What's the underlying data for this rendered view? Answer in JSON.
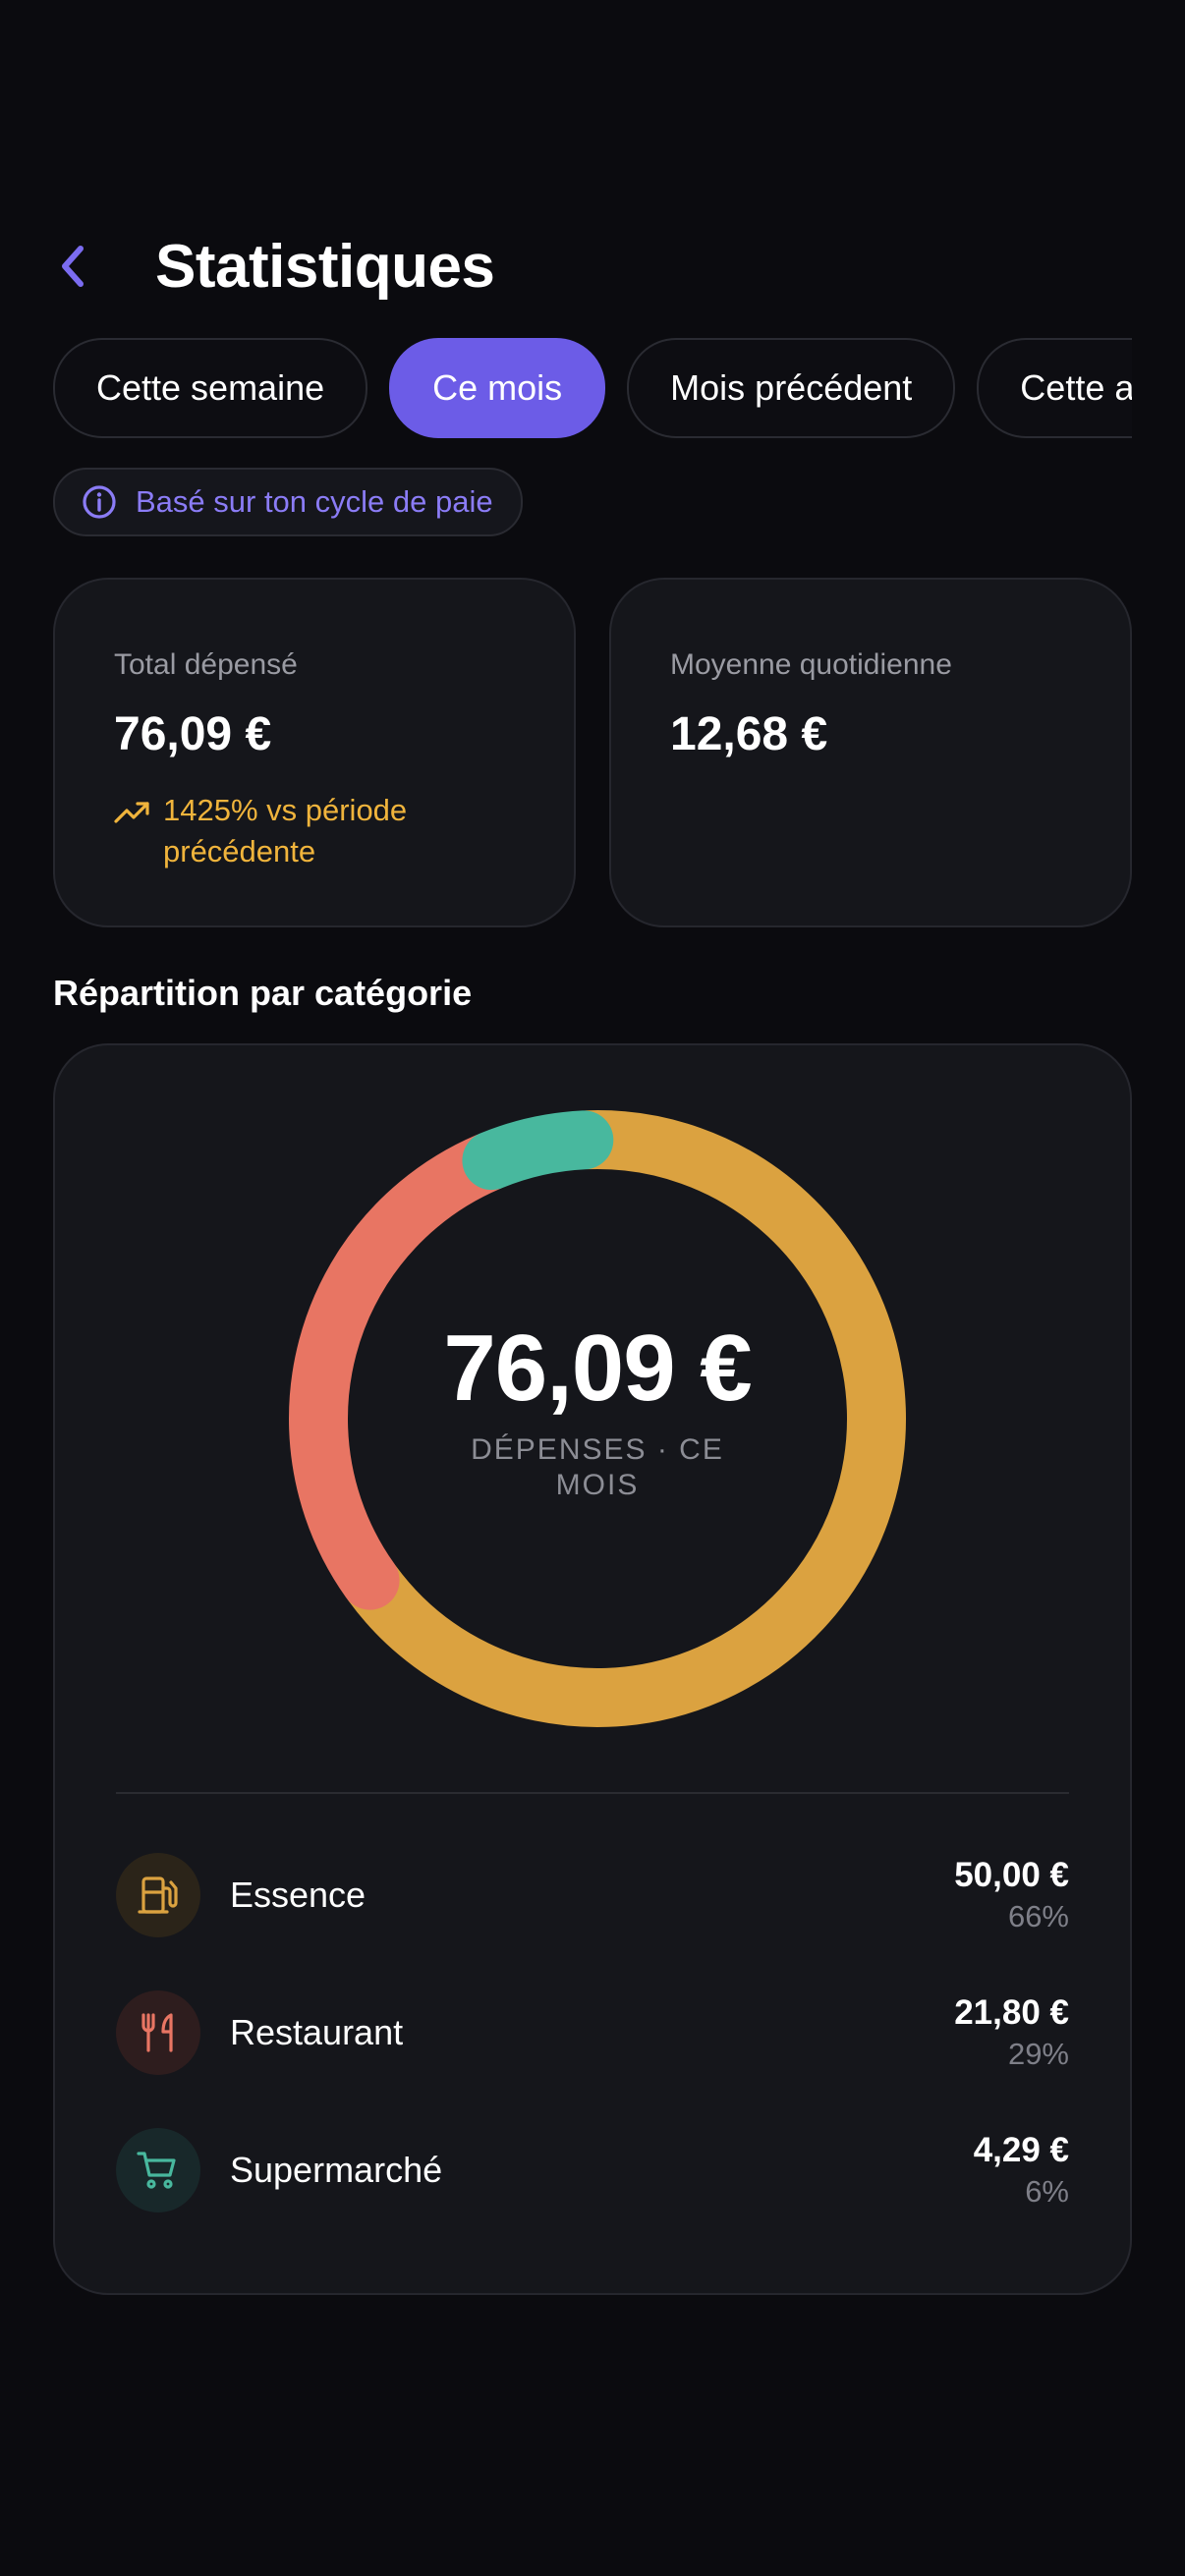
{
  "header": {
    "title": "Statistiques"
  },
  "tabs": [
    {
      "label": "Cette semaine",
      "active": false
    },
    {
      "label": "Ce mois",
      "active": true
    },
    {
      "label": "Mois précédent",
      "active": false
    },
    {
      "label": "Cette année",
      "active": false
    }
  ],
  "info": {
    "text": "Basé sur ton cycle de paie"
  },
  "stats": {
    "total": {
      "label": "Total dépensé",
      "value": "76,09 €",
      "change": "1425% vs période précédente"
    },
    "average": {
      "label": "Moyenne quotidienne",
      "value": "12,68 €"
    }
  },
  "breakdown": {
    "title": "Répartition par catégorie",
    "total": "76,09 €",
    "subtitle": "DÉPENSES · CE MOIS"
  },
  "chart_data": {
    "type": "pie",
    "categories": [
      "Essence",
      "Restaurant",
      "Supermarché"
    ],
    "values": [
      50.0,
      21.8,
      4.29
    ],
    "colors": [
      "#dba240",
      "#e87563",
      "#48b89e"
    ]
  },
  "categories": [
    {
      "name": "Essence",
      "amount": "50,00 €",
      "percent": "66%",
      "icon": "fuel-pump-icon",
      "color": "#dba240",
      "bg": "#2b2419"
    },
    {
      "name": "Restaurant",
      "amount": "21,80 €",
      "percent": "29%",
      "icon": "fork-knife-icon",
      "color": "#e87563",
      "bg": "#2e1d1e"
    },
    {
      "name": "Supermarché",
      "amount": "4,29 €",
      "percent": "6%",
      "icon": "shopping-cart-icon",
      "color": "#48b89e",
      "bg": "#18282a"
    }
  ],
  "colors": {
    "accent": "#6c5ce7",
    "warning": "#f0b43c",
    "background": "#0b0b0f",
    "card": "#15161b"
  }
}
